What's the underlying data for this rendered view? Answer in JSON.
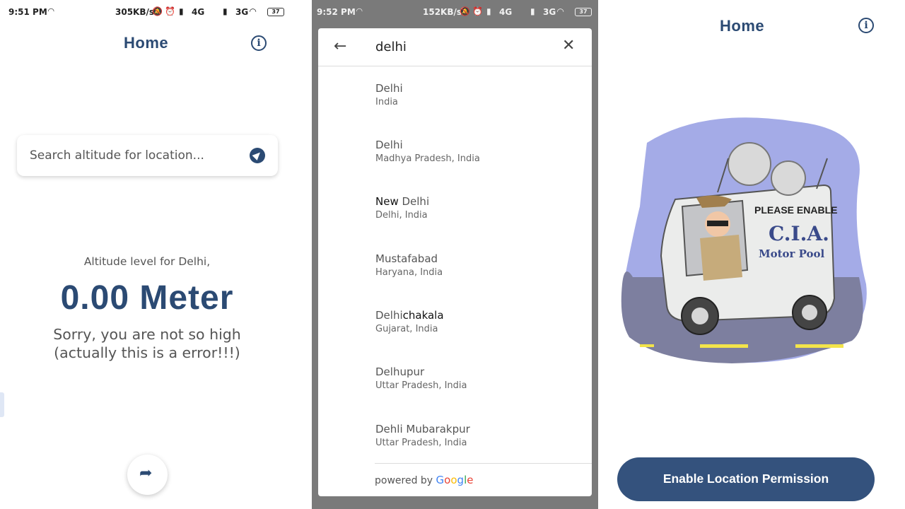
{
  "panel1": {
    "status": {
      "time": "9:51 PM",
      "speed": "305KB/s",
      "network1": "4G",
      "network2": "3G",
      "battery": "37"
    },
    "title": "Home",
    "info_icon": "info-circle-icon",
    "search": {
      "placeholder": "Search altitude for location..."
    },
    "altitude_label": "Altitude level for Delhi,",
    "altitude_value": "0.00 Meter",
    "message_line1": "Sorry, you are not so high",
    "message_line2": "(actually this is a error!!!)",
    "share_icon": "share-icon"
  },
  "panel2": {
    "status": {
      "time": "9:52 PM",
      "speed": "152KB/s",
      "network1": "4G",
      "network2": "3G",
      "battery": "37"
    },
    "query": "delhi",
    "results": [
      {
        "main_plain": "Delhi",
        "main_bold": "",
        "main_tail": "",
        "sub": "India"
      },
      {
        "main_plain": "Delhi",
        "main_bold": "",
        "main_tail": "",
        "sub": "Madhya Pradesh, India"
      },
      {
        "main_plain": "",
        "main_bold": "New",
        "main_tail": " Delhi",
        "sub": "Delhi, India"
      },
      {
        "main_plain": "Mustafabad",
        "main_bold": "",
        "main_tail": "",
        "sub": "Haryana, India"
      },
      {
        "main_plain": "Delhi",
        "main_bold": "chakala",
        "main_tail": "",
        "sub": "Gujarat, India"
      },
      {
        "main_plain": "Delhupur",
        "main_bold": "",
        "main_tail": "",
        "sub": "Uttar Pradesh, India"
      },
      {
        "main_plain": "Dehli Mubarakpur",
        "main_bold": "",
        "main_tail": "",
        "sub": "Uttar Pradesh, India"
      }
    ],
    "powered_by": "powered by",
    "google": [
      "G",
      "o",
      "o",
      "g",
      "l",
      "e"
    ]
  },
  "panel3": {
    "title": "Home",
    "illustration": {
      "sign_line1": "PLEASE ENABLE",
      "sign_line2": "C.I.A.",
      "sign_line3": "Motor Pool"
    },
    "enable_button": "Enable Location Permission"
  }
}
